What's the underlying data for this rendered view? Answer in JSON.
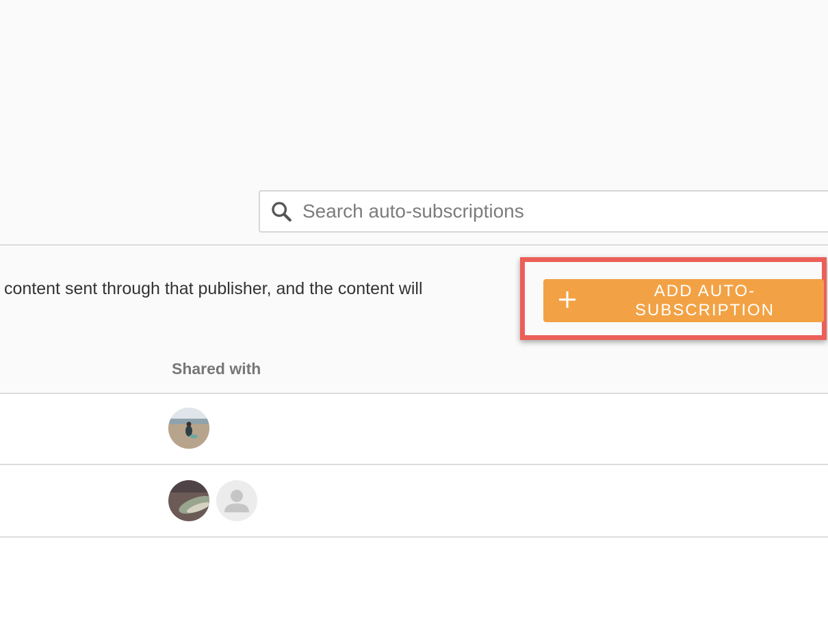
{
  "search": {
    "placeholder": "Search auto-subscriptions",
    "icon": "magnifier"
  },
  "description": "content sent through that publisher, and the content will",
  "add_button": {
    "label": "ADD AUTO-SUBSCRIPTION",
    "icon": "plus",
    "color": "#f2a245"
  },
  "highlight_color": "#ec5f58",
  "table": {
    "column_header": "Shared with",
    "rows": [
      {
        "shared_with": [
          "beach-photo-avatar"
        ]
      },
      {
        "shared_with": [
          "photo-avatar",
          "default-user-avatar"
        ]
      }
    ]
  }
}
